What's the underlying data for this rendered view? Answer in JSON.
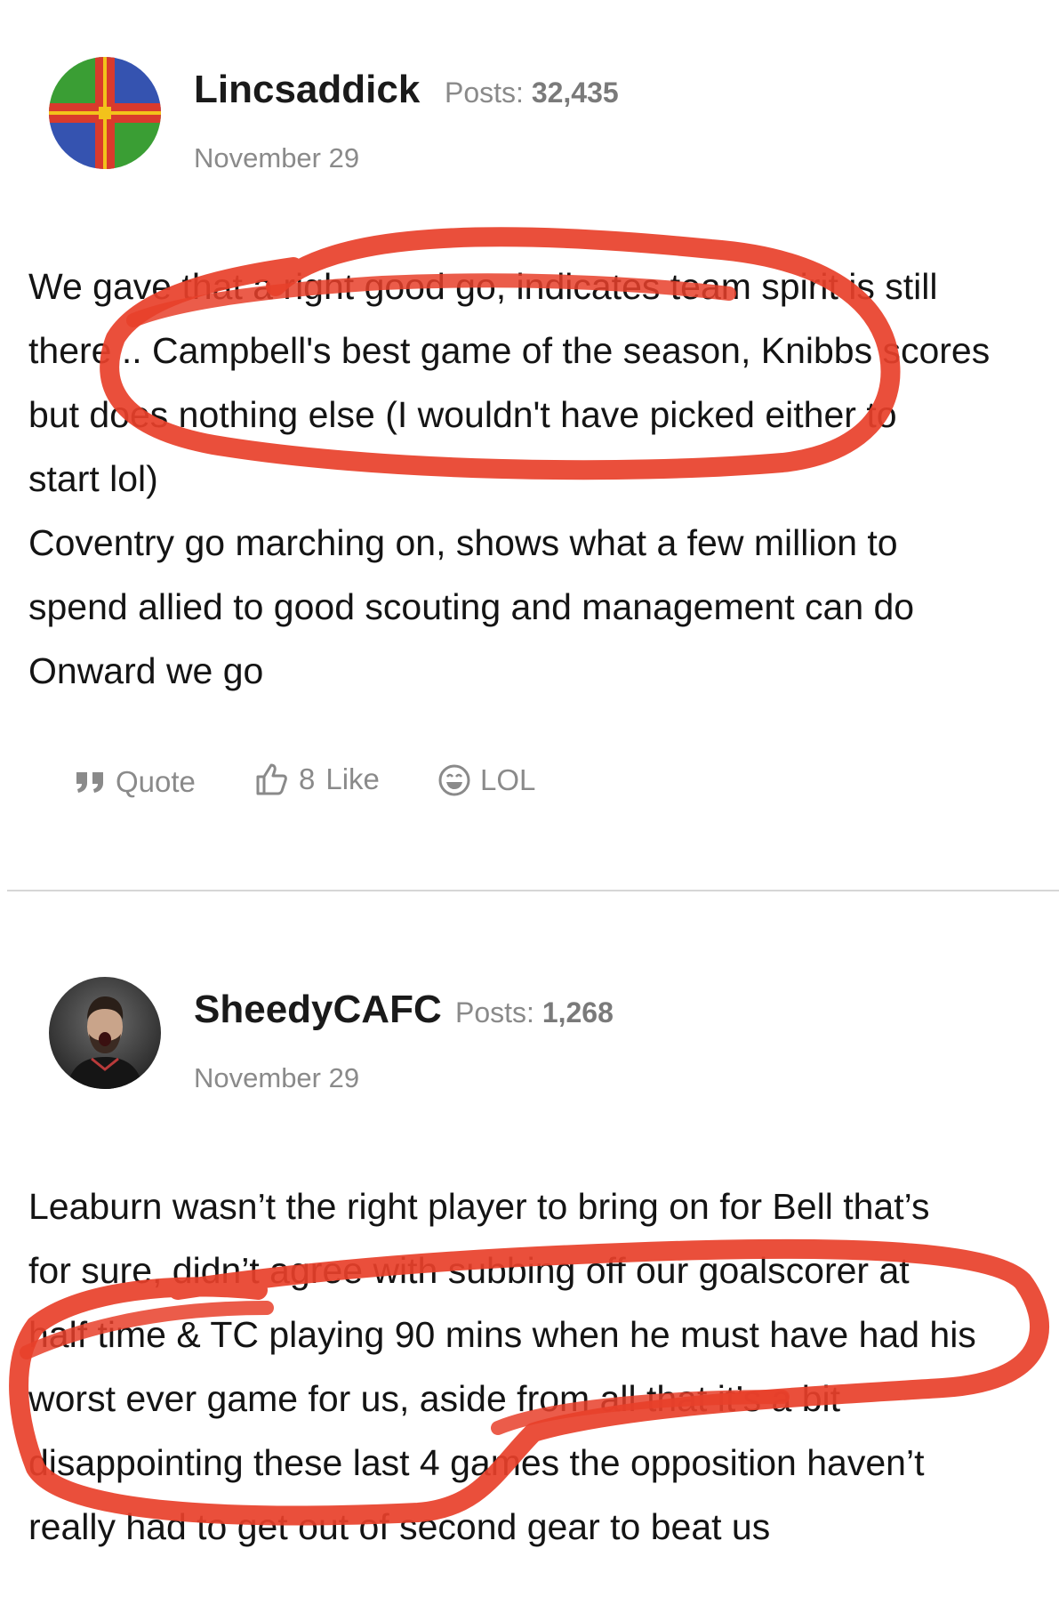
{
  "posts": [
    {
      "username": "Lincsaddick",
      "posts_label": "Posts:",
      "posts_count": "32,435",
      "date": "November 29",
      "avatar_icon": "lincolnshire-flag-icon",
      "body_lines": [
        "We gave that a right good go, indicates team spirit is still",
        "there .. Campbell's best game of the season, Knibbs scores",
        "but does nothing else (I wouldn't have picked either to",
        "start lol)",
        "Coventry go marching on, shows what a few million to",
        "spend allied to good scouting and management can do",
        "Onward we go"
      ],
      "actions": {
        "quote_label": "Quote",
        "like_count": "8",
        "like_label": "Like",
        "lol_label": "LOL"
      }
    },
    {
      "username": "SheedyCAFC",
      "posts_label": "Posts:",
      "posts_count": "1,268",
      "date": "November 29",
      "avatar_icon": "user-photo-avatar",
      "body_lines": [
        "Leaburn wasn’t the right player to bring on for Bell that’s",
        "for sure, didn’t agree with subbing off our goalscorer at",
        "half time & TC playing 90 mins when he must have had his",
        "worst ever game for us, aside from all that it’s a bit",
        "disappointing these last 4 games the opposition haven’t",
        "really had to get out of second gear to beat us"
      ]
    }
  ],
  "colors": {
    "annotation_red": "#e8402a",
    "meta_gray": "#8a8a8a",
    "divider": "#d6d6d6"
  }
}
